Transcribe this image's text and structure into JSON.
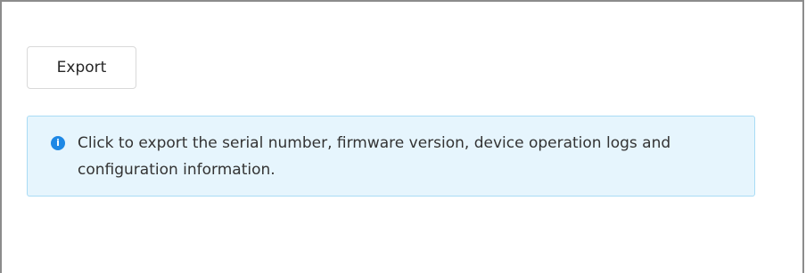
{
  "toolbar": {
    "export_label": "Export"
  },
  "info": {
    "icon": "info-icon",
    "icon_glyph": "i",
    "message": "Click to export the serial number, firmware version, device operation logs and configuration information."
  },
  "colors": {
    "info_background": "#e6f5fd",
    "info_border": "#a9dcf5",
    "info_icon": "#1e88e5"
  }
}
